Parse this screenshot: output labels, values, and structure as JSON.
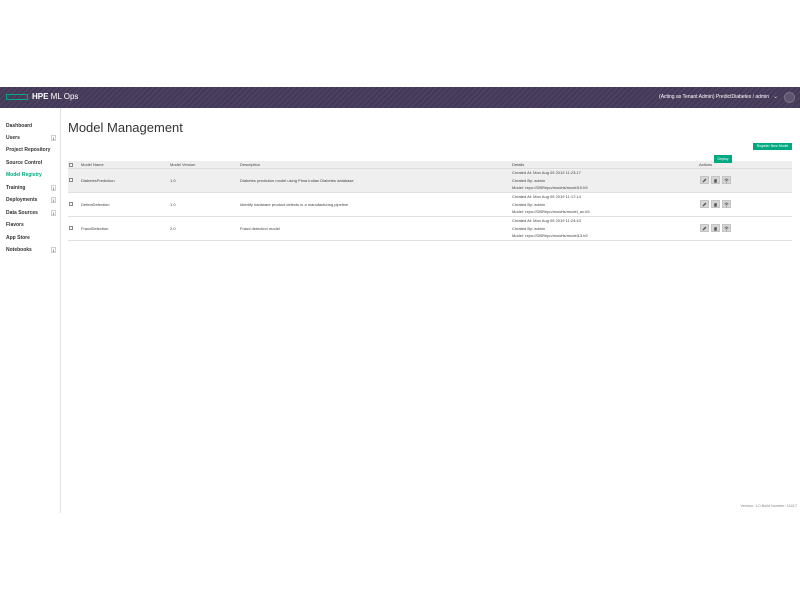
{
  "header": {
    "brand_bold": "HPE",
    "brand_rest": " ML Ops",
    "user_label": "(Acting as Tenant Admin) PredictDiabetes / admin"
  },
  "sidebar": {
    "items": [
      {
        "label": "Dashboard",
        "badge": ""
      },
      {
        "label": "Users",
        "badge": "1"
      },
      {
        "label": "Project Repository",
        "badge": ""
      },
      {
        "label": "Source Control",
        "badge": ""
      },
      {
        "label": "Model Registry",
        "badge": "",
        "active": true
      },
      {
        "label": "Training",
        "badge": "1"
      },
      {
        "label": "Deployments",
        "badge": "1"
      },
      {
        "label": "Data Sources",
        "badge": "1"
      },
      {
        "label": "Flavors",
        "badge": ""
      },
      {
        "label": "App Store",
        "badge": ""
      },
      {
        "label": "Notebooks",
        "badge": "1"
      }
    ]
  },
  "main": {
    "title": "Model Management",
    "register_label": "Register New Model",
    "tooltip": "Deploy"
  },
  "table": {
    "columns": [
      "Model Name",
      "Model Version",
      "Description",
      "Details",
      "Actions"
    ],
    "rows": [
      {
        "name": "DiabetesPrediction",
        "version": "1.0",
        "description": "Diabetes prediction model using Pima Indian Diabetes database",
        "created_at": "Created At: Mon Aug 05 2019 11:23:17",
        "created_by": "Created By: admin",
        "model_path": "Model: repo://DBRepo/models/model10.h5"
      },
      {
        "name": "DefectDetection",
        "version": "1.0",
        "description": "Identify hardware product defects in a manufacturing pipeline",
        "created_at": "Created At: Mon Aug 05 2019 11:17:14",
        "created_by": "Created By: admin",
        "model_path": "Model: repo://DBRepo/models/model_ac.h5"
      },
      {
        "name": "FraudDetection",
        "version": "2.0",
        "description": "Fraud detection model",
        "created_at": "Created At: Mon Aug 05 2019 11:24:43",
        "created_by": "Created By: admin",
        "model_path": "Model: repo://DBRepo/models/model13.h5"
      }
    ]
  },
  "footer": {
    "version": "Version: 1.0 Build Number: 11617"
  },
  "icons": {
    "edit": "pencil-icon",
    "delete": "trash-icon",
    "deploy": "deploy-icon"
  },
  "colors": {
    "accent": "#01a982",
    "topbar": "#453a5a"
  }
}
